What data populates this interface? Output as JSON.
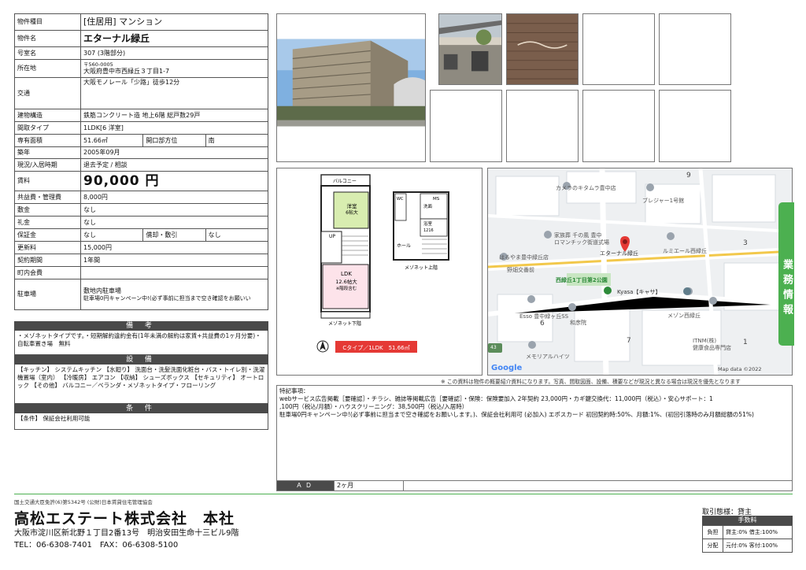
{
  "spec": {
    "type_label": "物件種目",
    "type_value": "[住居用] マンション",
    "name_label": "物件名",
    "name_value": "エターナル緑丘",
    "room_label": "号室名",
    "room_value": "307 (3階部分)",
    "address_label": "所在地",
    "postal": "〒560-0005",
    "address_value": "大阪府豊中市西緑丘３丁目1-7",
    "traffic_label": "交通",
    "traffic_value": "大阪モノレール「少路」徒歩12分",
    "structure_label": "建物構造",
    "structure_value": "鉄筋コンクリート造 地上6階 総戸数29戸",
    "layout_label": "間取タイプ",
    "layout_value": "1LDK[6 洋室]",
    "area_label": "専有面積",
    "area_value": "51.66㎡",
    "opening_label": "開口部方位",
    "opening_value": "南",
    "built_label": "築年",
    "built_value": "2005年09月",
    "status_label": "現況/入居時期",
    "status_value": "退去予定 / 相談",
    "rent_label": "賃料",
    "rent_value": "90,000 円",
    "fee_label": "共益費・管理費",
    "fee_value": "8,000円",
    "shikikin_label": "敷金",
    "shikikin_value": "なし",
    "reikin_label": "礼金",
    "reikin_value": "なし",
    "deposit_label": "保証金",
    "deposit_value": "なし",
    "amort_label": "償却・敷引",
    "amort_value": "なし",
    "renewal_label": "更新料",
    "renewal_value": "15,000円",
    "term_label": "契約期間",
    "term_value": "1年間",
    "council_label": "町内会費",
    "council_value": "",
    "parking_label": "駐車場",
    "parking_value": "敷地内駐車場",
    "parking_note": "駐車場0円キャンペーン中!(必ず事前に担当まで空き確認をお願いい"
  },
  "remarks": {
    "title": "備 考",
    "text": "・メゾネットタイプです。・短期解約違約金有(1年未満の解約は家賃+共益費の1ヶ月分要)・自転車置き場　無料"
  },
  "equipment": {
    "title": "設 備",
    "text": "【キッチン】 システムキッチン 【水廻り】 洗面台・洗髪洗面化粧台・バス・トイレ別・洗濯機置場（室内） 【冷暖房】 エアコン 【収納】 シューズボックス 【セキュリティ】 オートロック 【その他】 バルコニー／ベランダ・メゾネットタイプ・フローリング"
  },
  "conditions": {
    "title": "条 件",
    "text": "【条件】 保証会社利用可能"
  },
  "floorplan": {
    "balcony": "バルコニー",
    "western_room": "洋室",
    "western_size": "6帖大",
    "ldk": "LDK",
    "ldk_size": "12.6帖大",
    "ldk_note": "※階段含む",
    "up": "UP",
    "lower_label": "メゾネット下階",
    "upper_label": "メゾネット上階",
    "hall": "ホール",
    "bath": "浴室",
    "toilet": "トイレ",
    "washroom": "洗面",
    "ms": "MS",
    "bath_size": "1216",
    "wc": "WC",
    "type_badge": "Cタイプ／1LDK　51.66㎡"
  },
  "map": {
    "labels": [
      "カメラのキタムラ豊中店",
      "ブレジャー1号館",
      "家族葬 千の風 豊中",
      "ロマンチック街道式場",
      "エターナル緑丘",
      "ルミエール西緑丘",
      "はるやま豊中緑丘店",
      "西緑丘1丁目第2公園",
      "Kyasa【キャサ】",
      "メゾン西緑丘",
      "Esso 豊中緑ヶ丘SS",
      "和彦院",
      "ITNM(株)",
      "健康食品専門店",
      "メモリアルハイツ",
      "野畑交番前"
    ],
    "numbers": [
      "9",
      "3",
      "6",
      "7",
      "1",
      "43"
    ],
    "google": "Google",
    "credit": "Map data ©2022"
  },
  "side_tab": "業務情報",
  "disclaimer": "※ この資料は物件の概要紹介資料になります。写真、間取図面、設備、積要などが現況と異なる場合は現況を優先となります",
  "special": {
    "title": "特記事項：",
    "lines": [
      "webサービス広告掲載［要確認］・チラシ、雑誌等掲載広告［要確認］・保険：保険要加入 2年契約 23,000円・カギ鍵交換代：11,000円（税込）・安心サポート：1",
      ",100円（税込/月額）・ハウスクリーニング：38,500円（税込/入居時）",
      "駐車場0円キャンペーン中!(必ず事前に担当まで空き確認をお願いします。)、保証会社利用可 (必加入) エポスカード 初回契約時:50%、月額:1%、(初回引落時のみ月額総額の51%)"
    ]
  },
  "ad": {
    "label": "ＡＤ",
    "value": "2ヶ月"
  },
  "footer": {
    "license": "国土交通大臣免許(6)第5342号 (公財)日本賃貸住宅管理協会",
    "company": "高松エステート株式会社　本社",
    "address": "大阪市淀川区新北野１丁目2番13号　明治安田生命十三ビル9階",
    "tel": "TEL：06-6308-7401　FAX：06-6308-5100"
  },
  "fee_box": {
    "torihiki": "取引態様：貸主",
    "head": "手数料",
    "rows": [
      {
        "label": "負担",
        "value": "貸主:0%  借主:100%"
      },
      {
        "label": "分配",
        "value": "元付:0%  客付:100%"
      }
    ]
  },
  "colors": {
    "accent_green": "#4cb050",
    "header_dark": "#4a4a4a",
    "pin_red": "#e53935",
    "type_badge_red": "#e53935"
  }
}
